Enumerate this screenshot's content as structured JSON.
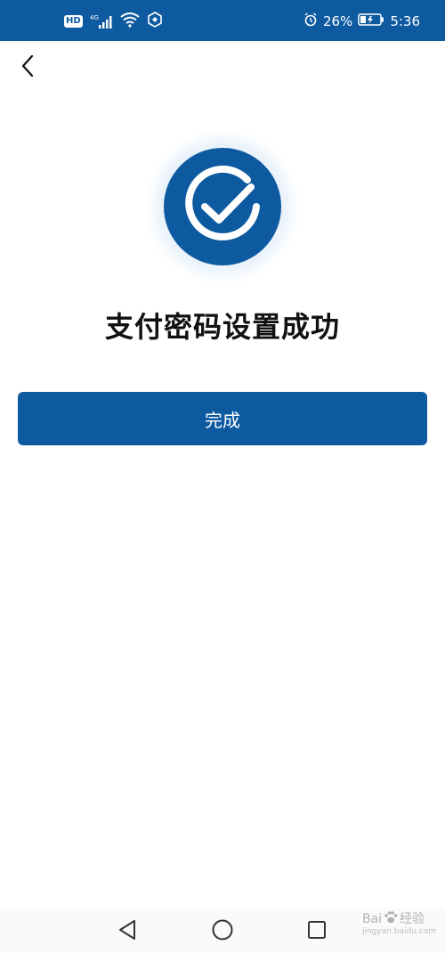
{
  "status_bar": {
    "hd_label": "HD",
    "network_label": "4G",
    "battery_percent": "26%",
    "time": "5:36",
    "icons": [
      "hd-icon",
      "signal-icon",
      "wifi-icon",
      "hotspot-icon",
      "alarm-icon",
      "battery-charging-icon"
    ]
  },
  "header": {
    "back_icon": "chevron-left-icon"
  },
  "main": {
    "icon": "check-circle-icon",
    "title": "支付密码设置成功",
    "done_label": "完成"
  },
  "nav_bar": {
    "icons": [
      "back-triangle-icon",
      "home-circle-icon",
      "recents-square-icon"
    ]
  },
  "watermark": {
    "brand": "Bai",
    "brand_suffix": "经验",
    "url": "jingyan.baidu.com"
  },
  "colors": {
    "primary": "#0e5aa0",
    "background": "#ffffff",
    "text": "#111111"
  }
}
